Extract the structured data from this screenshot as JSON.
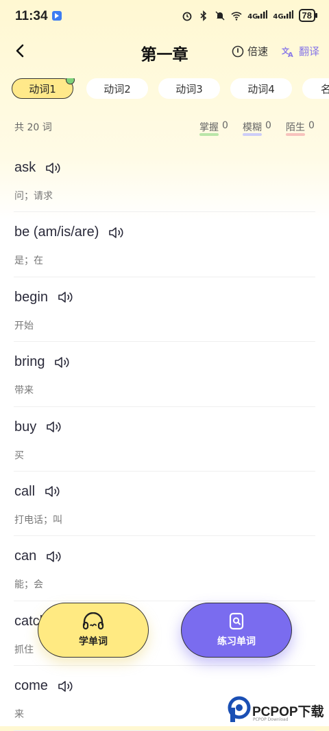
{
  "status": {
    "time": "11:34",
    "signal1": "4G",
    "signal2": "4G",
    "battery": "78"
  },
  "header": {
    "title": "第一章",
    "speed_label": "倍速",
    "translate_label": "翻译"
  },
  "tabs": [
    {
      "label": "动词1",
      "active": true
    },
    {
      "label": "动词2",
      "active": false
    },
    {
      "label": "动词3",
      "active": false
    },
    {
      "label": "动词4",
      "active": false
    },
    {
      "label": "名",
      "active": false
    }
  ],
  "summary": {
    "total_text": "共 20 词",
    "mastered_label": "掌握",
    "mastered_count": "0",
    "fuzzy_label": "模糊",
    "fuzzy_count": "0",
    "unknown_label": "陌生",
    "unknown_count": "0"
  },
  "words": [
    {
      "word": "ask",
      "meaning": "问；请求"
    },
    {
      "word": "be (am/is/are)",
      "meaning": "是；在"
    },
    {
      "word": "begin",
      "meaning": "开始"
    },
    {
      "word": "bring",
      "meaning": "带来"
    },
    {
      "word": "buy",
      "meaning": "买"
    },
    {
      "word": "call",
      "meaning": "打电话；叫"
    },
    {
      "word": "can",
      "meaning": "能；会"
    },
    {
      "word": "catch",
      "meaning": "抓住"
    },
    {
      "word": "come",
      "meaning": "来"
    }
  ],
  "actions": {
    "learn_label": "学单词",
    "practice_label": "练习单词"
  },
  "watermark": {
    "text": "PCPOP下载",
    "sub": "PCPOP Download"
  },
  "colors": {
    "accent_yellow": "#ffea82",
    "accent_purple": "#7a6cef",
    "mastered": "#b9e6a8",
    "fuzzy": "#cdcdf7",
    "unknown": "#f7c2bd"
  }
}
